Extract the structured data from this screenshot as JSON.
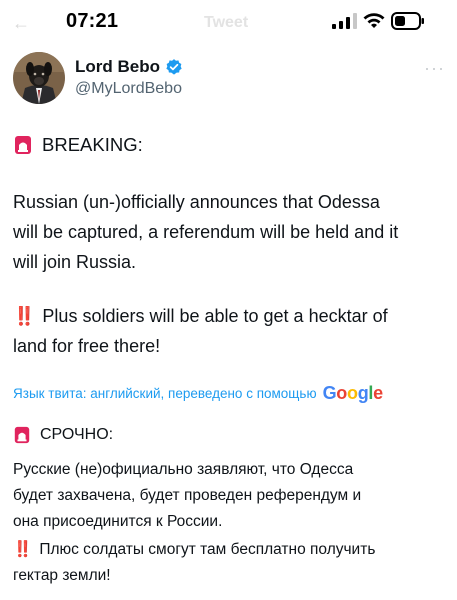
{
  "status_bar": {
    "time": "07:21",
    "ghost_back": "←",
    "ghost_title": "Tweet",
    "icons": [
      "cellular-signal-icon",
      "wifi-icon",
      "battery-icon"
    ]
  },
  "author": {
    "name": "Lord Bebo",
    "handle": "@MyLordBebo",
    "verified": true,
    "more": "···",
    "verified_color": "#1d9bf0"
  },
  "tweet_en": {
    "headline": "BREAKING:",
    "paragraph1": [
      "Russian (un-)officially announces that Odessa",
      "will be captured, a referendum will be held and it",
      "will join Russia."
    ],
    "paragraph2_prefix": "‼️",
    "paragraph2": [
      "Plus soldiers will be able to get a hecktar of",
      "land for free there!"
    ]
  },
  "translation": {
    "note": "Язык твита: английский, переведено с помощью",
    "brand": [
      "G",
      "o",
      "o",
      "g",
      "l",
      "e"
    ],
    "brand_colors": [
      "#4285F4",
      "#EA4335",
      "#FBBC05",
      "#4285F4",
      "#34A853",
      "#EA4335"
    ]
  },
  "tweet_ru": {
    "headline": "СРОЧНО:",
    "paragraph1": [
      "Русские (не)официально заявляют, что Одесса",
      "будет захвачена, будет проведен референдум и",
      "она присоединится к России."
    ],
    "paragraph2_prefix": "‼️",
    "paragraph2": [
      "Плюс солдаты смогут там бесплатно получить",
      "гектар земли!"
    ]
  },
  "colors": {
    "link": "#1d9bf0",
    "text": "#0f1419",
    "muted": "#536471",
    "siren": "#e0245e"
  }
}
